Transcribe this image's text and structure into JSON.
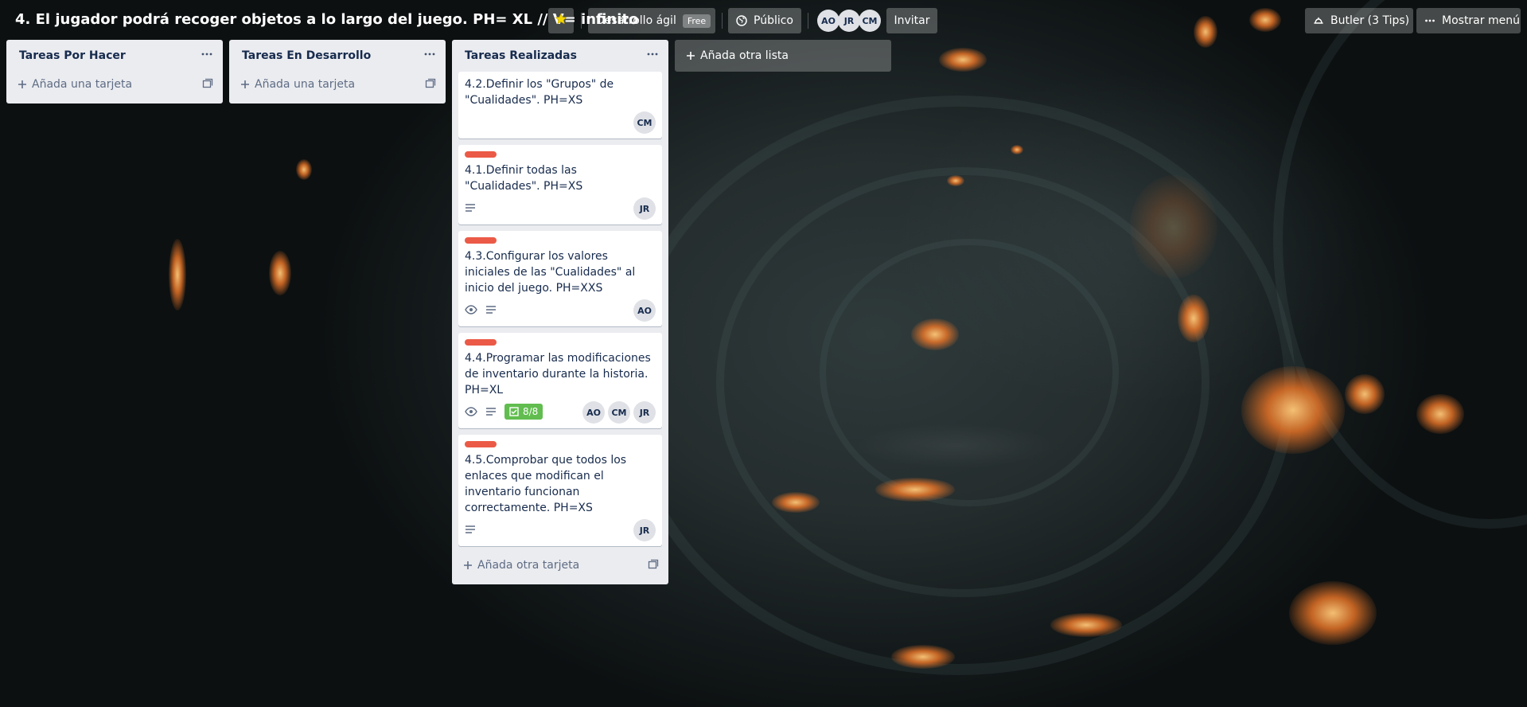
{
  "board": {
    "title": "4. El jugador podrá recoger objetos a lo largo del juego. PH= XL // V= infinito",
    "team_label": "Desarrollo ágil",
    "team_badge": "Free",
    "visibility_label": "Público",
    "members": [
      "AO",
      "JR",
      "CM"
    ],
    "invite_label": "Invitar",
    "butler_label": "Butler (3 Tips)",
    "menu_label": "Mostrar menú"
  },
  "lists": [
    {
      "title": "Tareas Por Hacer",
      "add_card_label": "Añada una tarjeta",
      "cards": []
    },
    {
      "title": "Tareas En Desarrollo",
      "add_card_label": "Añada una tarjeta",
      "cards": []
    },
    {
      "title": "Tareas Realizadas",
      "add_card_label": "Añada otra tarjeta",
      "cards": [
        {
          "title": "4.2.Definir los \"Grupos\" de \"Cualidades\". PH=XS",
          "label_color": null,
          "badges": [],
          "members": [
            "CM"
          ]
        },
        {
          "title": "4.1.Definir todas las \"Cualidades\". PH=XS",
          "label_color": "#eb5a46",
          "badges": [
            "description-icon"
          ],
          "members": [
            "JR"
          ]
        },
        {
          "title": "4.3.Configurar los valores iniciales de las \"Cualidades\" al inicio del juego. PH=XXS",
          "label_color": "#eb5a46",
          "badges": [
            "watch-icon",
            "description-icon"
          ],
          "members": [
            "AO"
          ]
        },
        {
          "title": "4.4.Programar las modificaciones de inventario durante la historia. PH=XL",
          "label_color": "#eb5a46",
          "badges": [
            "watch-icon",
            "description-icon"
          ],
          "checklist": "8/8",
          "members": [
            "AO",
            "CM",
            "JR"
          ]
        },
        {
          "title": "4.5.Comprobar que todos los enlaces que modifican el inventario funcionan correctamente. PH=XS",
          "label_color": "#eb5a46",
          "badges": [
            "description-icon"
          ],
          "members": [
            "JR"
          ]
        }
      ]
    }
  ],
  "add_list_label": "Añada otra lista",
  "colors": {
    "label_red": "#eb5a46",
    "checklist_complete": "#61bd4f",
    "list_bg": "#ebecf0",
    "star": "#f2d600"
  }
}
